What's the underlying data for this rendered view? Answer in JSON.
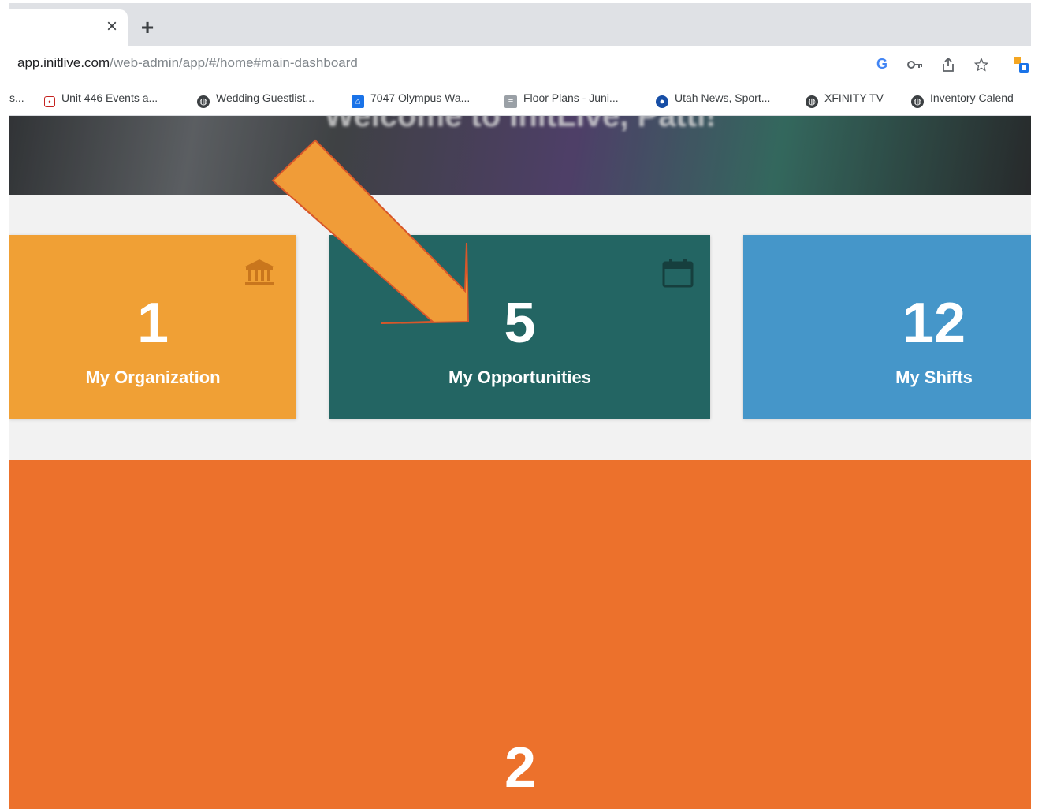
{
  "browser": {
    "tab": {
      "close_glyph": "×"
    },
    "new_tab_glyph": "+",
    "address": {
      "host": "app.initlive.com",
      "path": "/web-admin/app/#/home#main-dashboard"
    },
    "toolbar_icons": [
      "google-icon",
      "key-icon",
      "share-icon",
      "star-icon",
      "extension-icon"
    ],
    "bookmarks": [
      {
        "label": "s...",
        "icon": "none"
      },
      {
        "label": "Unit 446 Events a...",
        "icon": "calendar-favicon"
      },
      {
        "label": "Wedding Guestlist...",
        "icon": "globe-icon"
      },
      {
        "label": "7047 Olympus Wa...",
        "icon": "house-favicon"
      },
      {
        "label": "Floor Plans - Juni...",
        "icon": "floorplan-favicon"
      },
      {
        "label": "Utah News, Sport...",
        "icon": "news-favicon"
      },
      {
        "label": "XFINITY TV",
        "icon": "globe-icon"
      },
      {
        "label": "Inventory Calend",
        "icon": "globe-icon"
      }
    ]
  },
  "hero": {
    "title": "Welcome to InitLive, Patti!"
  },
  "cards": [
    {
      "count": "1",
      "label": "My Organization",
      "color": "#f0a035",
      "icon": "bank-icon"
    },
    {
      "count": "5",
      "label": "My Opportunities",
      "color": "#236563",
      "icon": "calendar-icon"
    },
    {
      "count": "12",
      "label": "My Shifts",
      "color": "#4596c9",
      "icon": "none"
    }
  ],
  "panel": {
    "count": "2",
    "color": "#ec712c"
  },
  "annotation": {
    "type": "arrow",
    "color": "#f09c38",
    "points_to": "My Opportunities"
  }
}
